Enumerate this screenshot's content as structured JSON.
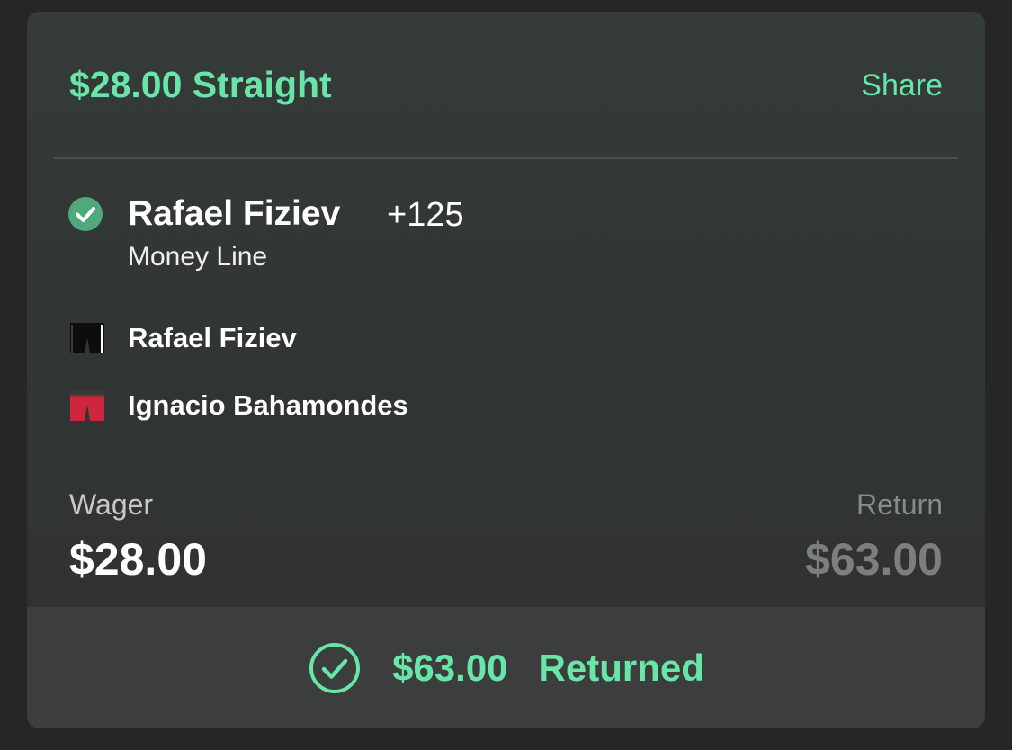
{
  "bet": {
    "title": "$28.00 Straight",
    "share_label": "Share"
  },
  "selection": {
    "name": "Rafael Fiziev",
    "odds": "+125",
    "market": "Money Line",
    "status_icon": "check-circle-icon"
  },
  "fighters": [
    {
      "name": "Rafael Fiziev",
      "icon": "trunks-black-icon",
      "color": "#0d0d0d"
    },
    {
      "name": "Ignacio Bahamondes",
      "icon": "trunks-red-icon",
      "color": "#d0253e"
    }
  ],
  "wager": {
    "label": "Wager",
    "value": "$28.00"
  },
  "return": {
    "label": "Return",
    "value": "$63.00"
  },
  "result": {
    "amount": "$63.00",
    "status": "Returned",
    "icon": "check-circle-outline-icon"
  },
  "colors": {
    "accent": "#67e6a8",
    "win_badge": "#4ea97c",
    "background": "#262626",
    "card": "#303433"
  }
}
